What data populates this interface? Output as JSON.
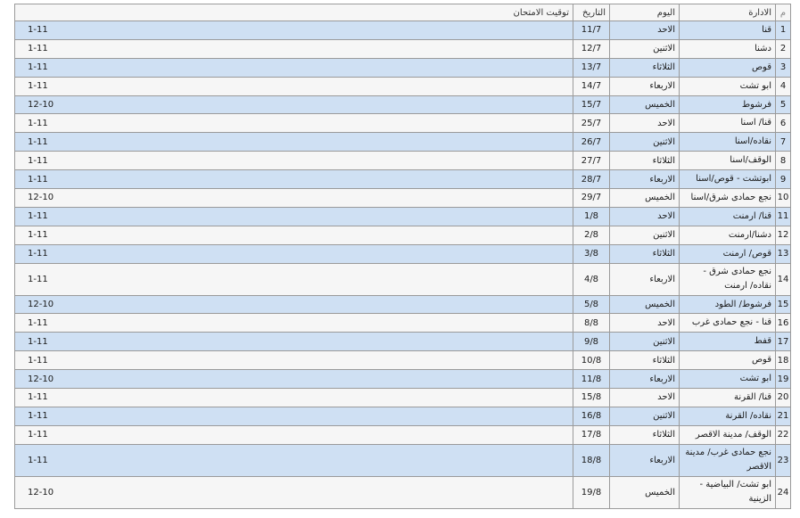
{
  "headers": {
    "num": "م",
    "dept": "الادارة",
    "day": "اليوم",
    "date": "التاريخ",
    "time": "توقيت الامتحان"
  },
  "rows": [
    {
      "num": "1",
      "dept": "قنا",
      "day": "الاحد",
      "date": "11/7",
      "time": "1-11"
    },
    {
      "num": "2",
      "dept": "دشنا",
      "day": "الاثنين",
      "date": "12/7",
      "time": "1-11"
    },
    {
      "num": "3",
      "dept": "قوص",
      "day": "الثلاثاء",
      "date": "13/7",
      "time": "1-11"
    },
    {
      "num": "4",
      "dept": "ابو تشت",
      "day": "الاربعاء",
      "date": "14/7",
      "time": "1-11"
    },
    {
      "num": "5",
      "dept": "فرشوط",
      "day": "الخميس",
      "date": "15/7",
      "time": "12-10"
    },
    {
      "num": "6",
      "dept": "قنا/ اسنا",
      "day": "الاحد",
      "date": "25/7",
      "time": "1-11"
    },
    {
      "num": "7",
      "dept": "نقاده/اسنا",
      "day": "الاثنين",
      "date": "26/7",
      "time": "1-11"
    },
    {
      "num": "8",
      "dept": "الوقف/اسنا",
      "day": "الثلاثاء",
      "date": "27/7",
      "time": "1-11"
    },
    {
      "num": "9",
      "dept": "ابوتشت - قوص/اسنا",
      "day": "الاربعاء",
      "date": "28/7",
      "time": "1-11"
    },
    {
      "num": "10",
      "dept": "نجع حمادى شرق/اسنا",
      "day": "الخميس",
      "date": "29/7",
      "time": "12-10"
    },
    {
      "num": "11",
      "dept": "قنا/ ارمنت",
      "day": "الاحد",
      "date": "1/8",
      "time": "1-11"
    },
    {
      "num": "12",
      "dept": "دشنا/ارمنت",
      "day": "الاثنين",
      "date": "2/8",
      "time": "1-11"
    },
    {
      "num": "13",
      "dept": "قوص/ ارمنت",
      "day": "الثلاثاء",
      "date": "3/8",
      "time": "1-11"
    },
    {
      "num": "14",
      "dept": "نجع حمادى شرق - نقاده/ ارمنت",
      "day": "الاربعاء",
      "date": "4/8",
      "time": "1-11"
    },
    {
      "num": "15",
      "dept": "فرشوط/ الطود",
      "day": "الخميس",
      "date": "5/8",
      "time": "12-10"
    },
    {
      "num": "16",
      "dept": "قنا - نجع حمادى غرب",
      "day": "الاحد",
      "date": "8/8",
      "time": "1-11"
    },
    {
      "num": "17",
      "dept": "قفط",
      "day": "الاثنين",
      "date": "9/8",
      "time": "1-11"
    },
    {
      "num": "18",
      "dept": "قوص",
      "day": "الثلاثاء",
      "date": "10/8",
      "time": "1-11"
    },
    {
      "num": "19",
      "dept": "ابو تشت",
      "day": "الاربعاء",
      "date": "11/8",
      "time": "12-10"
    },
    {
      "num": "20",
      "dept": "قنا/ القرنة",
      "day": "الاحد",
      "date": "15/8",
      "time": "1-11"
    },
    {
      "num": "21",
      "dept": "نقاده/ القرنة",
      "day": "الاثنين",
      "date": "16/8",
      "time": "1-11"
    },
    {
      "num": "22",
      "dept": "الوقف/ مدينة الاقصر",
      "day": "الثلاثاء",
      "date": "17/8",
      "time": "1-11"
    },
    {
      "num": "23",
      "dept": "نجع حمادى غرب/ مدينة الاقصر",
      "day": "الاربعاء",
      "date": "18/8",
      "time": "1-11"
    },
    {
      "num": "24",
      "dept": "ابو تشت/ البياضية - الزينية",
      "day": "الخميس",
      "date": "19/8",
      "time": "12-10"
    }
  ]
}
